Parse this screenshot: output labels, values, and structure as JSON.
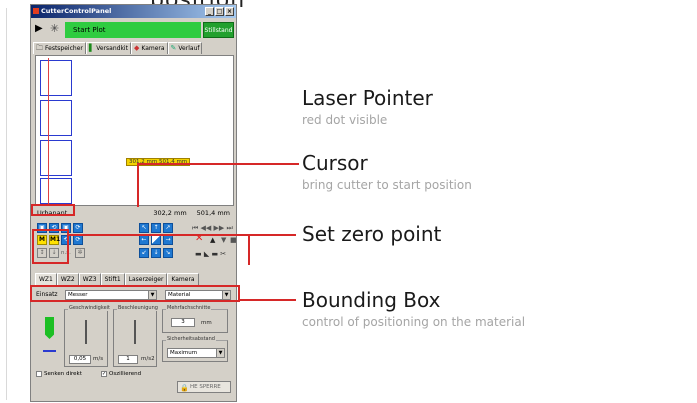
{
  "top_fragment": "position",
  "window": {
    "title": "CutterControlPanel",
    "buttons": [
      "_",
      "□",
      "×"
    ]
  },
  "plotbar": {
    "start_label": "Start Plot",
    "status_label": "Stillstand"
  },
  "tabs": [
    {
      "label": "Festspeicher",
      "icon": "folder-icon"
    },
    {
      "label": "Versandkit",
      "icon": "pin-icon"
    },
    {
      "label": "Kamera",
      "icon": "camera-icon"
    },
    {
      "label": "Verlauf",
      "icon": "pencil-icon"
    }
  ],
  "canvas": {
    "cursor_label": "301,2 mm  501,4 mm"
  },
  "statusbar": {
    "left": "Urbanant",
    "x": "302,2 mm",
    "y": "501,4 mm"
  },
  "controls": {
    "m_label": "M",
    "m1_label": "M1",
    "n_label": "n.s."
  },
  "tool_tabs": [
    "WZ1",
    "WZ2",
    "WZ3",
    "Stift1",
    "Laserzeiger",
    "Kamera"
  ],
  "tool": {
    "label": "Einsatz",
    "selected": "Messer",
    "material": "Material"
  },
  "groups": {
    "speed_label": "Geschwindigkeit",
    "accel_label": "Beschleunigung",
    "multi_label": "Mehrfachschnitte",
    "distance_label": "Sicherheitsabstand",
    "speed_value": "0,05",
    "speed_unit": "m/s",
    "accel_value": "1",
    "accel_unit": "m/s2",
    "multi_value": "3",
    "multi_unit": "mm",
    "distance_value": "Maximum"
  },
  "checkboxes": [
    {
      "label": "Senken direkt",
      "checked": false
    },
    {
      "label": "Oszillierend",
      "checked": true
    }
  ],
  "lock_label": "HE SPERRE",
  "annotations": [
    {
      "title": "Laser Pointer",
      "subtitle": "red dot visible"
    },
    {
      "title": "Cursor",
      "subtitle": "bring cutter to start position"
    },
    {
      "title": "Set zero point",
      "subtitle": ""
    },
    {
      "title": "Bounding Box",
      "subtitle": "control of positioning on the material"
    }
  ],
  "colors": {
    "accent_red": "#d62828",
    "start_green": "#2ecc40",
    "control_blue": "#1f78d1",
    "cursor_yellow": "#f2d200"
  }
}
